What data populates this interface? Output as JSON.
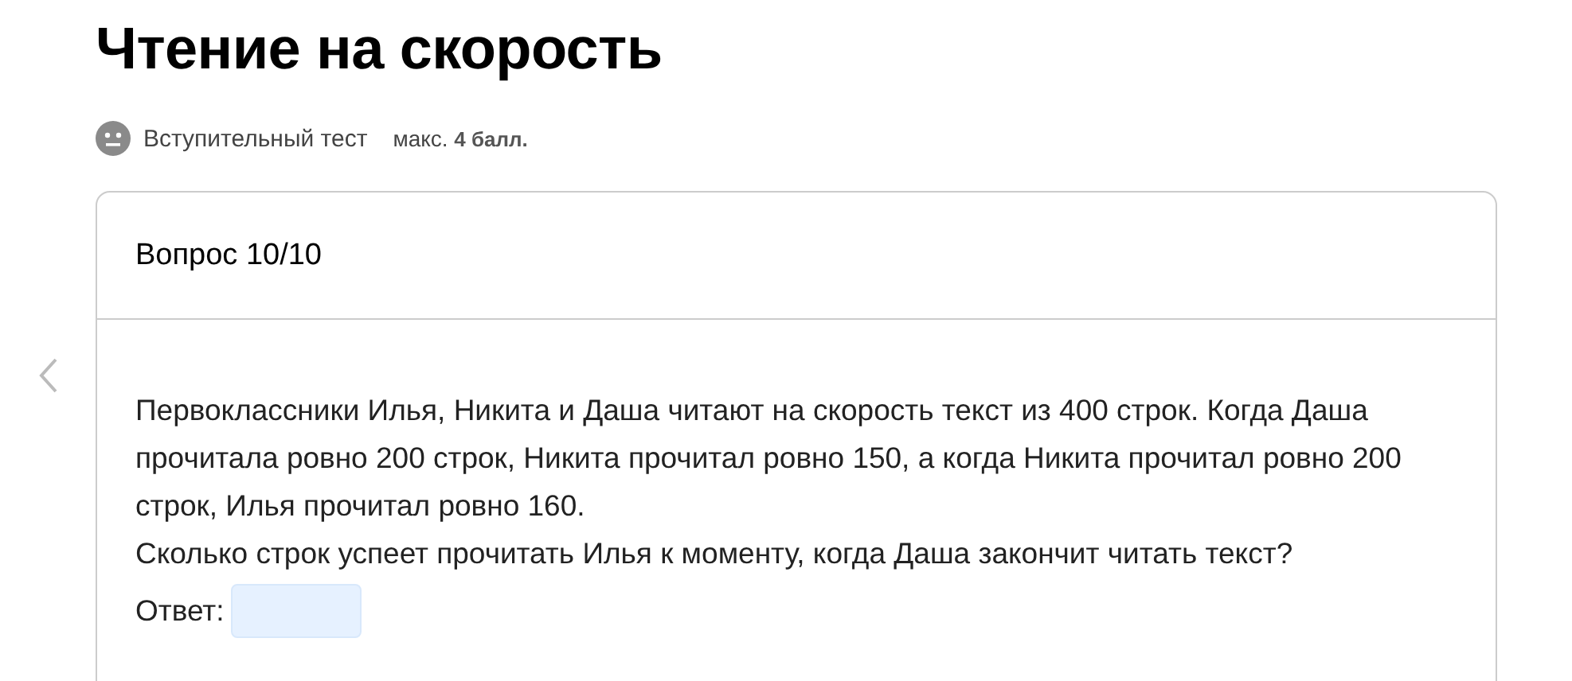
{
  "title": "Чтение на скорость",
  "meta": {
    "label": "Вступительный тест",
    "max_label": "макс.",
    "max_value": "4 балл."
  },
  "question": {
    "header": "Вопрос 10/10",
    "paragraphs": [
      "Первоклассники Илья, Никита и Даша читают на скорость текст из 400 строк. Когда Даша прочитала ровно 200 строк, Никита прочитал ровно 150, а когда Никита прочитал ровно 200 строк, Илья прочитал ровно 160.",
      "Сколько строк успеет прочитать Илья к моменту, когда Даша закончит читать текст?"
    ],
    "answer_label": "Ответ:"
  }
}
